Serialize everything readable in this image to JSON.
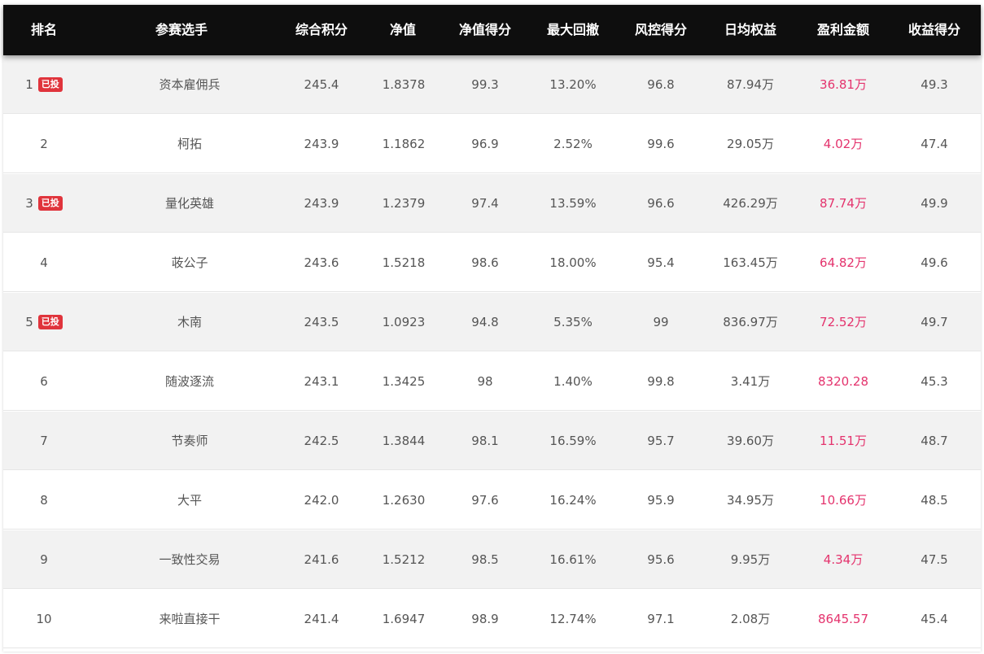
{
  "table": {
    "headers": [
      "排名",
      "参赛选手",
      "综合积分",
      "净值",
      "净值得分",
      "最大回撤",
      "风控得分",
      "日均权益",
      "盈利金额",
      "收益得分"
    ],
    "badge_label": "已投",
    "colors": {
      "header_bg": "#0e0e0e",
      "profit_text": "#e4336d",
      "badge_bg": "#e0343c",
      "odd_row_bg": "#f2f2f2"
    },
    "rows": [
      {
        "rank": "1",
        "badge": "已投",
        "player": "资本雇佣兵",
        "score": "245.4",
        "nav": "1.8378",
        "nav_score": "99.3",
        "max_dd": "13.20%",
        "risk_score": "96.8",
        "daily_equity": "87.94万",
        "profit": "36.81万",
        "return_score": "49.3"
      },
      {
        "rank": "2",
        "badge": "",
        "player": "柯拓",
        "score": "243.9",
        "nav": "1.1862",
        "nav_score": "96.9",
        "max_dd": "2.52%",
        "risk_score": "99.6",
        "daily_equity": "29.05万",
        "profit": "4.02万",
        "return_score": "47.4"
      },
      {
        "rank": "3",
        "badge": "已投",
        "player": "量化英雄",
        "score": "243.9",
        "nav": "1.2379",
        "nav_score": "97.4",
        "max_dd": "13.59%",
        "risk_score": "96.6",
        "daily_equity": "426.29万",
        "profit": "87.74万",
        "return_score": "49.9"
      },
      {
        "rank": "4",
        "badge": "",
        "player": "荍公子",
        "score": "243.6",
        "nav": "1.5218",
        "nav_score": "98.6",
        "max_dd": "18.00%",
        "risk_score": "95.4",
        "daily_equity": "163.45万",
        "profit": "64.82万",
        "return_score": "49.6"
      },
      {
        "rank": "5",
        "badge": "已投",
        "player": "木南",
        "score": "243.5",
        "nav": "1.0923",
        "nav_score": "94.8",
        "max_dd": "5.35%",
        "risk_score": "99",
        "daily_equity": "836.97万",
        "profit": "72.52万",
        "return_score": "49.7"
      },
      {
        "rank": "6",
        "badge": "",
        "player": "随波逐流",
        "score": "243.1",
        "nav": "1.3425",
        "nav_score": "98",
        "max_dd": "1.40%",
        "risk_score": "99.8",
        "daily_equity": "3.41万",
        "profit": "8320.28",
        "return_score": "45.3"
      },
      {
        "rank": "7",
        "badge": "",
        "player": "节奏师",
        "score": "242.5",
        "nav": "1.3844",
        "nav_score": "98.1",
        "max_dd": "16.59%",
        "risk_score": "95.7",
        "daily_equity": "39.60万",
        "profit": "11.51万",
        "return_score": "48.7"
      },
      {
        "rank": "8",
        "badge": "",
        "player": "大平",
        "score": "242.0",
        "nav": "1.2630",
        "nav_score": "97.6",
        "max_dd": "16.24%",
        "risk_score": "95.9",
        "daily_equity": "34.95万",
        "profit": "10.66万",
        "return_score": "48.5"
      },
      {
        "rank": "9",
        "badge": "",
        "player": "一致性交易",
        "score": "241.6",
        "nav": "1.5212",
        "nav_score": "98.5",
        "max_dd": "16.61%",
        "risk_score": "95.6",
        "daily_equity": "9.95万",
        "profit": "4.34万",
        "return_score": "47.5"
      },
      {
        "rank": "10",
        "badge": "",
        "player": "来啦直接干",
        "score": "241.4",
        "nav": "1.6947",
        "nav_score": "98.9",
        "max_dd": "12.74%",
        "risk_score": "97.1",
        "daily_equity": "2.08万",
        "profit": "8645.57",
        "return_score": "45.4"
      }
    ]
  }
}
